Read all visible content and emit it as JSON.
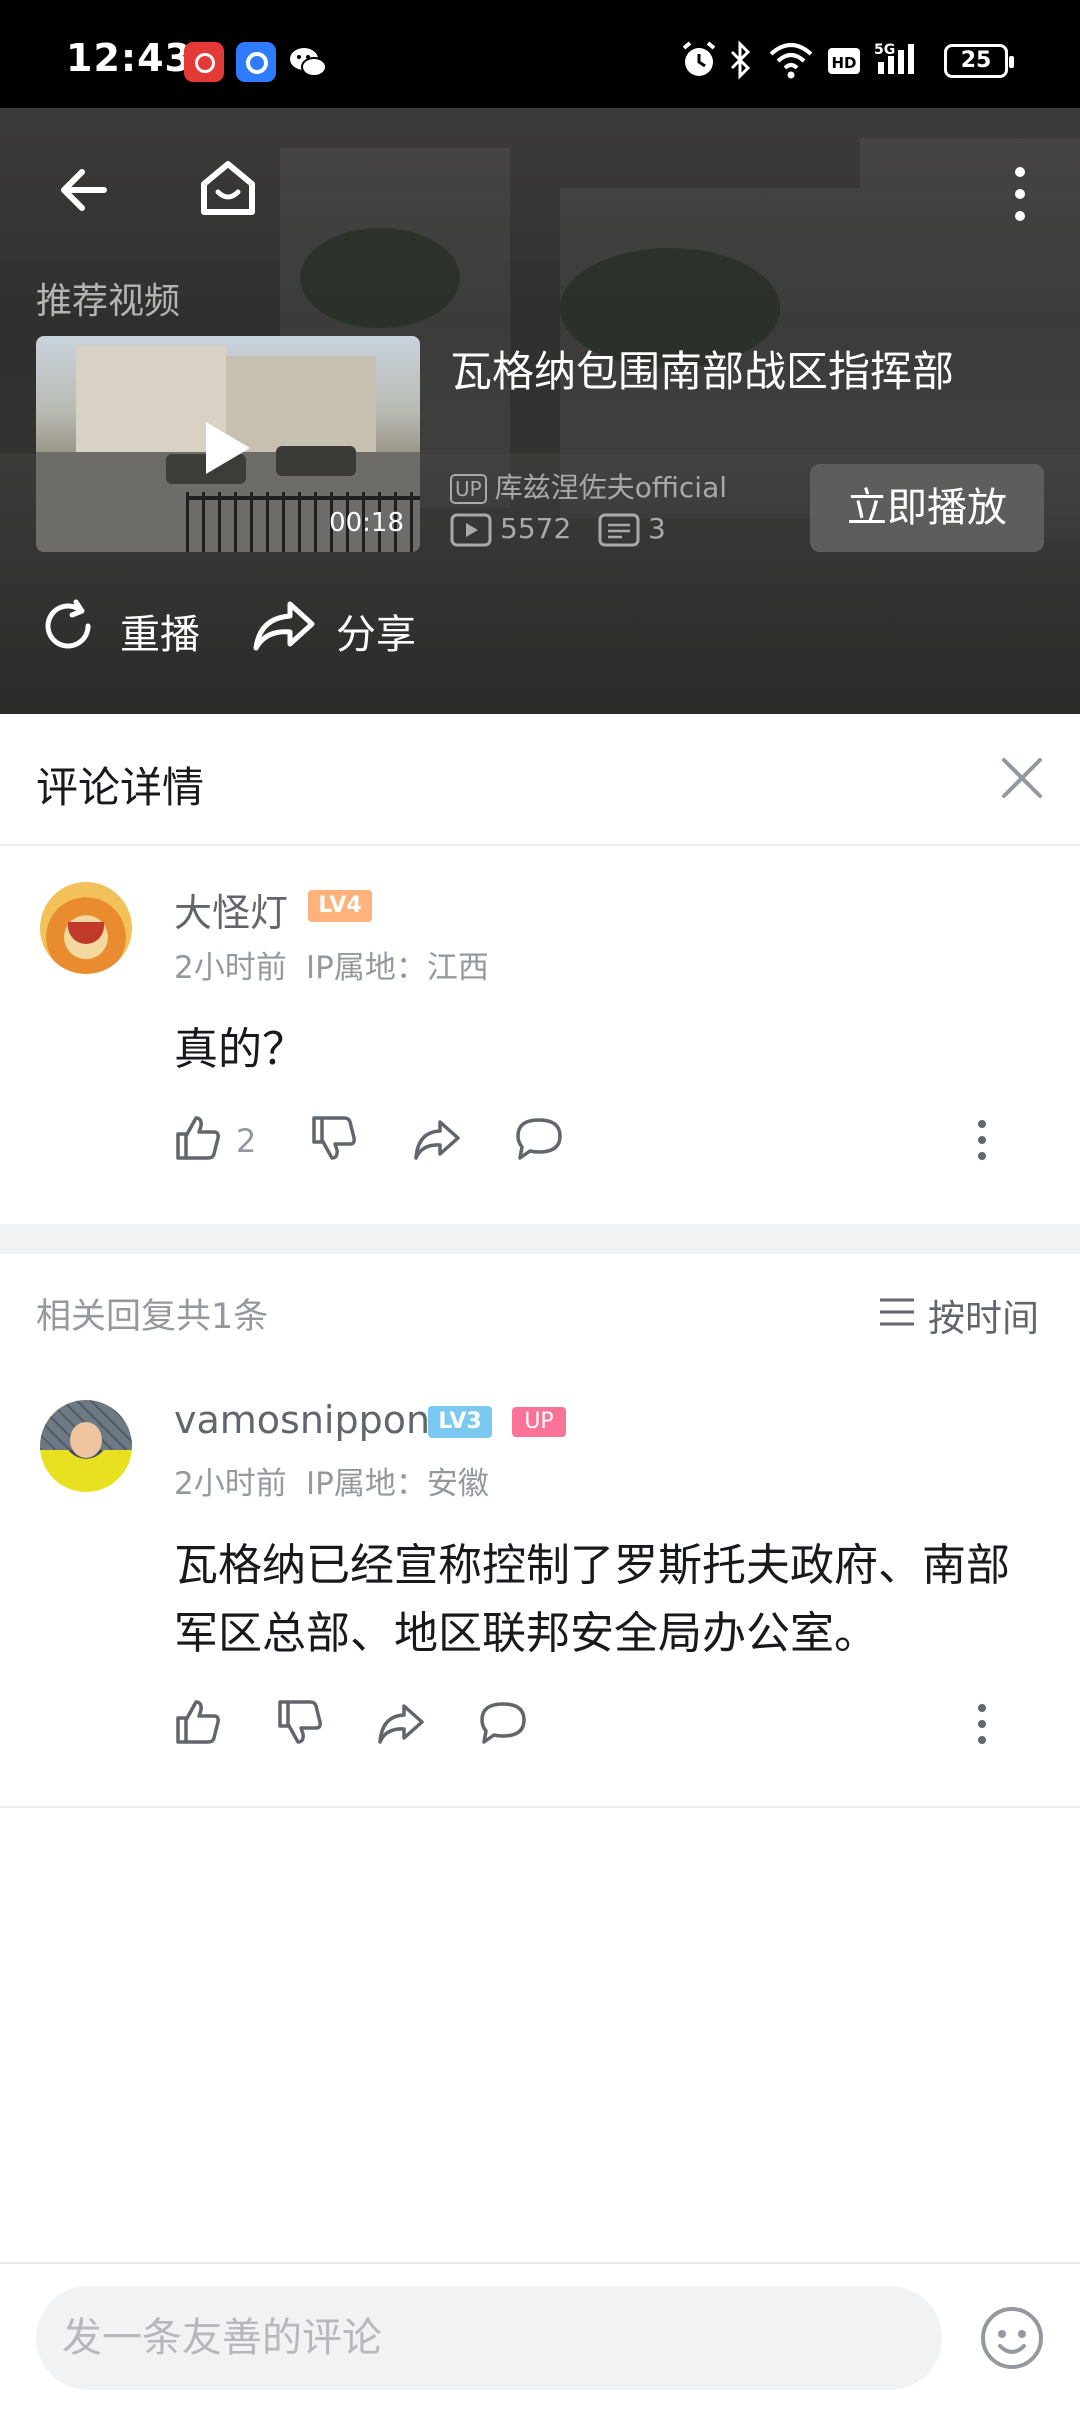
{
  "status_bar": {
    "time": "12:43",
    "battery": "25"
  },
  "video": {
    "section_label": "推荐视频",
    "title": "瓦格纳包围南部战区指挥部",
    "duration": "00:18",
    "up_badge": "UP",
    "uploader": "库兹涅佐夫official",
    "plays": "5572",
    "comments": "3",
    "play_now_label": "立即播放",
    "replay_label": "重播",
    "share_label": "分享"
  },
  "comment_panel": {
    "title": "评论详情"
  },
  "main_comment": {
    "username": "大怪灯",
    "level": "LV4",
    "time": "2小时前",
    "location": "IP属地：江西",
    "text": "真的？",
    "likes": "2"
  },
  "replies_header": {
    "count_text": "相关回复共1条",
    "sort_label": "按时间"
  },
  "reply": {
    "username": "vamosnippon",
    "level": "LV3",
    "up_badge": "UP",
    "time": "2小时前",
    "location": "IP属地：安徽",
    "text_line1": "瓦格纳已经宣称控制了罗斯托夫政府、南部",
    "text_line2": "军区总部、地区联邦安全局办公室。"
  },
  "input": {
    "placeholder": "发一条友善的评论"
  },
  "colors": {
    "accent_pink": "#fb7299",
    "level4": "#ffb27a",
    "level3": "#7bc8f0",
    "text_secondary": "#9499a0"
  }
}
